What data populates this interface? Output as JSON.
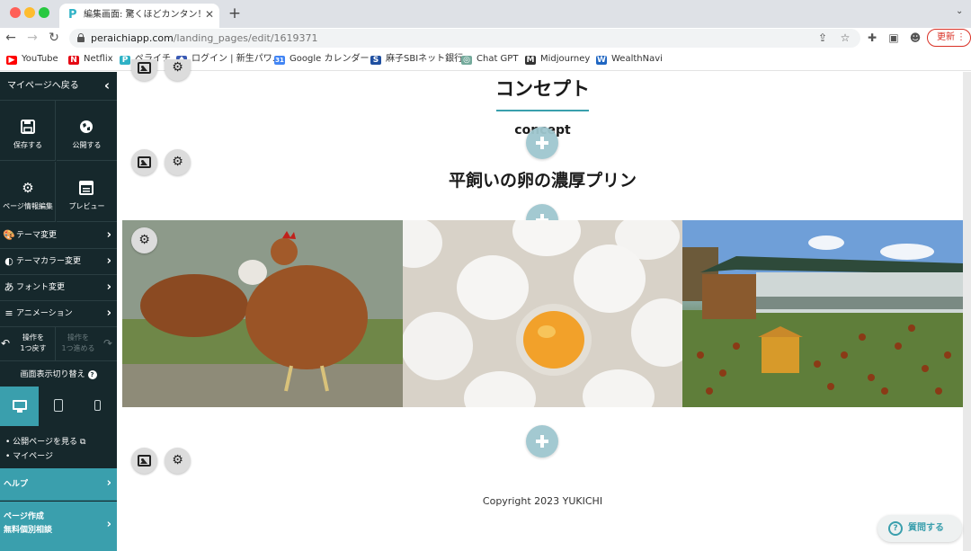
{
  "browser": {
    "tab_title": "編集画面: 驚くほどカンタン！無料",
    "tab_close": "✕",
    "new_tab": "+",
    "url_host": "peraichiapp.com",
    "url_path": "/landing_pages/edit/1619371",
    "update_label": "更新",
    "update_dots": "⋮"
  },
  "bookmarks": [
    {
      "label": "YouTube",
      "color": "#ff0000",
      "glyph": "▶"
    },
    {
      "label": "Netflix",
      "color": "#e50914",
      "glyph": "N"
    },
    {
      "label": "ペライチ",
      "color": "#2fb2c6",
      "glyph": "P"
    },
    {
      "label": "ログイン | 新生パワ...",
      "color": "#3b5bb5",
      "glyph": "♦"
    },
    {
      "label": "Google カレンダー",
      "color": "#4285f4",
      "glyph": "31"
    },
    {
      "label": "麻子SBIネット銀行",
      "color": "#1f4fa0",
      "glyph": "S"
    },
    {
      "label": "Chat GPT",
      "color": "#74aa9c",
      "glyph": "◎"
    },
    {
      "label": "Midjourney",
      "color": "#333333",
      "glyph": "M"
    },
    {
      "label": "WealthNavi",
      "color": "#1f66c2",
      "glyph": "W"
    }
  ],
  "sidebar": {
    "back_label": "マイページへ戻る",
    "tiles": {
      "save": "保存する",
      "publish": "公開する",
      "page_info": "ページ情報編集",
      "preview": "プレビュー"
    },
    "rows": {
      "theme": "テーマ変更",
      "theme_color": "テーマカラー変更",
      "font": "フォント変更",
      "animation": "アニメーション"
    },
    "undo_label": "操作を\n1つ戻す",
    "redo_label": "操作を\n1つ進める",
    "view_title": "画面表示切り替え",
    "links": {
      "public_page": "公開ページを見る",
      "mypage": "マイページ"
    },
    "help": "ヘルプ",
    "consult": "ページ作成\n無料個別相談"
  },
  "canvas": {
    "section_title": "コンセプト",
    "section_sub": "concept",
    "heading": "平飼いの卵の濃厚プリン",
    "copyright": "Copyright 2023 YUKICHI",
    "ask_label": "質問する"
  },
  "colors": {
    "sidebar_bg": "#16282c",
    "accent": "#3a9fad",
    "add_button": "#9fc7cf"
  }
}
